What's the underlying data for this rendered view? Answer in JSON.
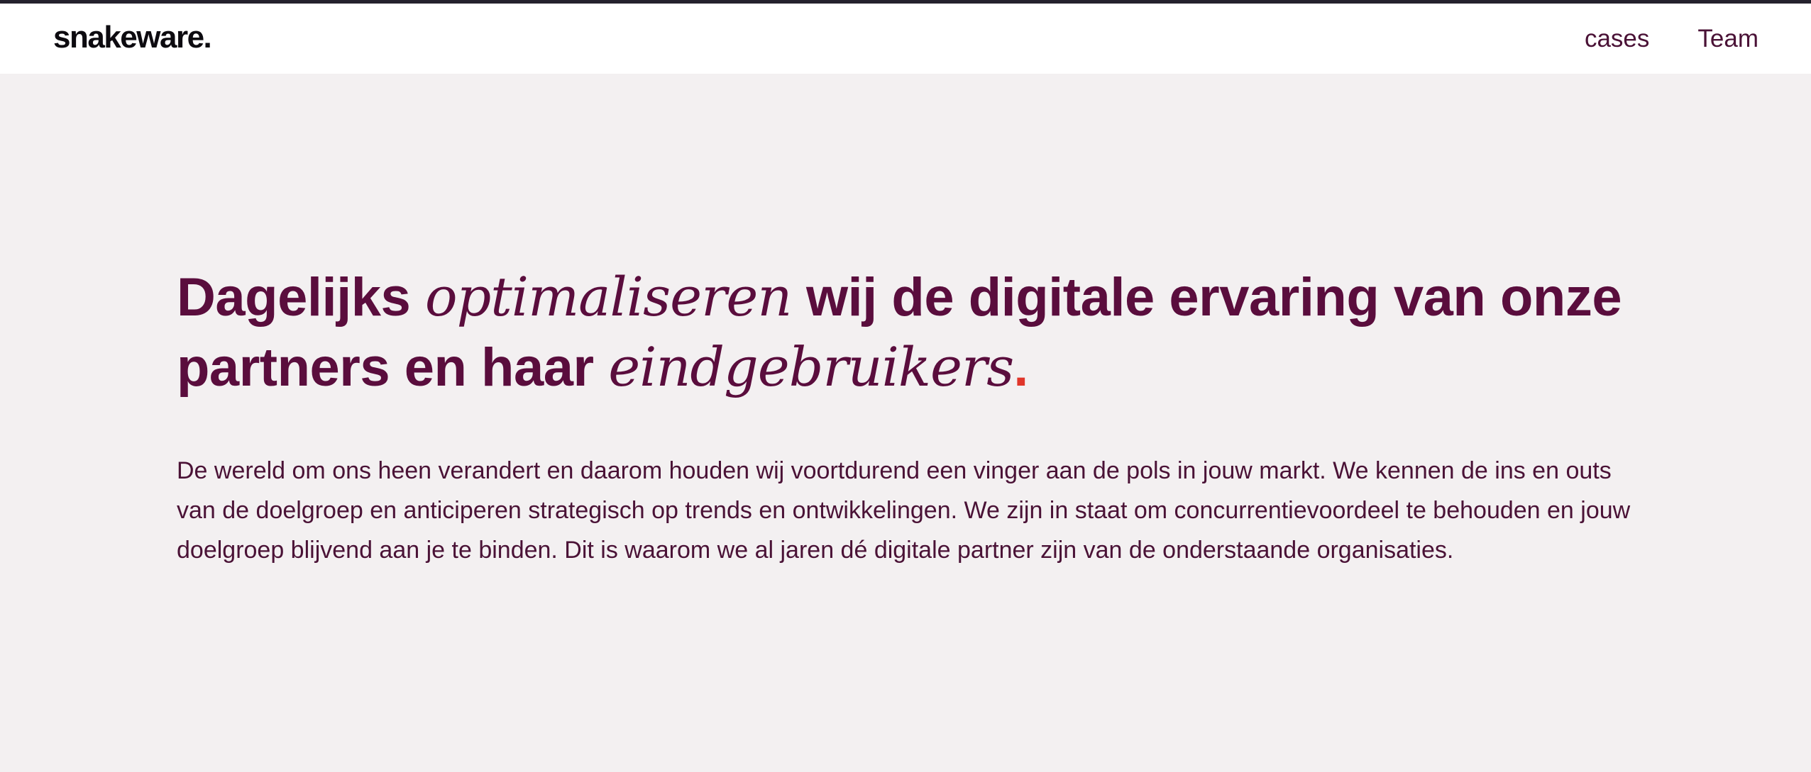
{
  "brand": {
    "logo_text": "snakeware."
  },
  "nav": {
    "items": [
      {
        "label": "cases"
      },
      {
        "label": "Team"
      }
    ]
  },
  "hero": {
    "headline": {
      "part1": "Dagelijks ",
      "part2_italic": "optimaliseren",
      "part3": " wij de digitale ervaring van onze partners en haar ",
      "part4_italic": "eindgebruikers",
      "part5_dot": "."
    },
    "intro": "De wereld om ons heen verandert en daarom houden wij voortdurend een vinger aan de pols in jouw markt. We kennen de ins en outs van de doelgroep en anticiperen strategisch op trends en ontwikkelingen. We zijn in staat om concurrentievoordeel te behouden en jouw doelgroep blijvend aan je te binden. Dit is waarom we al jaren dé digitale partner zijn van de onderstaande organisaties."
  },
  "colors": {
    "top_bar": "#24222d",
    "header_bg": "#ffffff",
    "page_bg": "#f3f0f1",
    "headline": "#5a0d3d",
    "body_text": "#4a1236",
    "accent_dot": "#e0362a"
  }
}
